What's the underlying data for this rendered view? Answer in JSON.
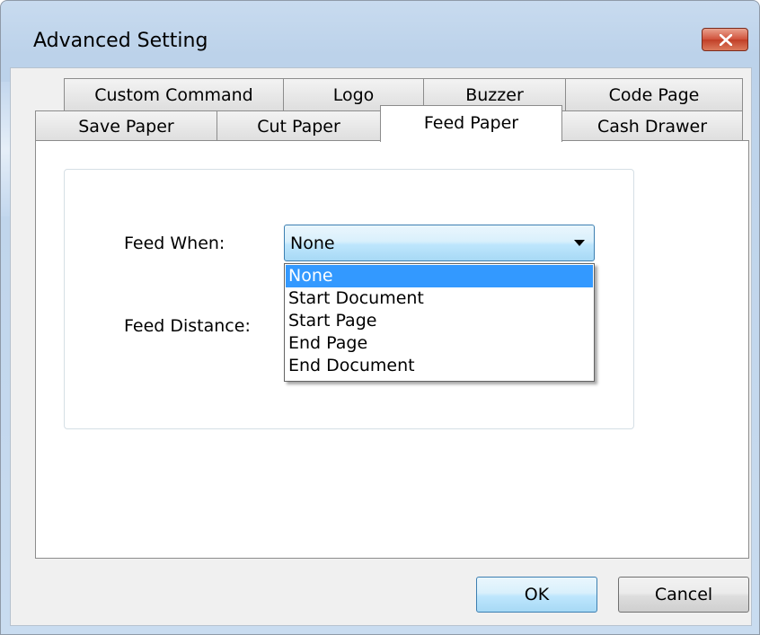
{
  "window": {
    "title": "Advanced Setting"
  },
  "tabs": {
    "row1": [
      "Custom Command",
      "Logo",
      "Buzzer",
      "Code Page"
    ],
    "row2": [
      "Save Paper",
      "Cut Paper",
      "Feed Paper",
      "Cash Drawer"
    ],
    "active": "Feed Paper"
  },
  "feed_paper": {
    "feed_when_label": "Feed When:",
    "feed_distance_label": "Feed Distance:",
    "feed_when_value": "None",
    "options": [
      "None",
      "Start Document",
      "Start Page",
      "End Page",
      "End Document"
    ],
    "highlighted_option": "None"
  },
  "buttons": {
    "ok": "OK",
    "cancel": "Cancel"
  },
  "icons": {
    "close": "close-icon",
    "dropdown": "chevron-down-icon"
  },
  "colors": {
    "selection": "#3399ff",
    "close_button": "#c94a31"
  }
}
